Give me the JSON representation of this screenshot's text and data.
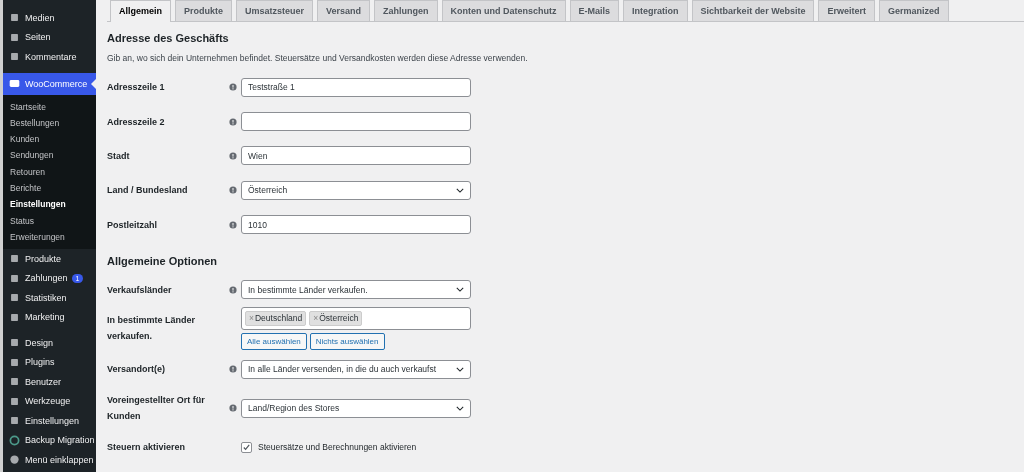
{
  "sidebar": {
    "groups": [
      [
        {
          "label": "Medien",
          "selected": false
        },
        {
          "label": "Seiten",
          "selected": false
        },
        {
          "label": "Kommentare",
          "selected": false
        }
      ],
      [
        {
          "label": "WooCommerce",
          "selected": true,
          "children": [
            {
              "label": "Startseite",
              "selected": false
            },
            {
              "label": "Bestellungen",
              "selected": false
            },
            {
              "label": "Kunden",
              "selected": false
            },
            {
              "label": "Sendungen",
              "selected": false
            },
            {
              "label": "Retouren",
              "selected": false
            },
            {
              "label": "Berichte",
              "selected": false
            },
            {
              "label": "Einstellungen",
              "selected": true
            },
            {
              "label": "Status",
              "selected": false
            },
            {
              "label": "Erweiterungen",
              "selected": false
            }
          ]
        },
        {
          "label": "Produkte",
          "selected": false
        },
        {
          "label": "Zahlungen",
          "selected": false,
          "badge": "1"
        },
        {
          "label": "Statistiken",
          "selected": false
        },
        {
          "label": "Marketing",
          "selected": false
        }
      ],
      [
        {
          "label": "Design",
          "selected": false
        },
        {
          "label": "Plugins",
          "selected": false
        },
        {
          "label": "Benutzer",
          "selected": false
        },
        {
          "label": "Werkzeuge",
          "selected": false
        },
        {
          "label": "Einstellungen",
          "selected": false
        },
        {
          "label": "Backup Migration",
          "selected": false
        },
        {
          "label": "Menü einklappen",
          "selected": false
        }
      ]
    ]
  },
  "tabs": [
    {
      "label": "Allgemein",
      "selected": true
    },
    {
      "label": "Produkte",
      "selected": false
    },
    {
      "label": "Umsatzsteuer",
      "selected": false
    },
    {
      "label": "Versand",
      "selected": false
    },
    {
      "label": "Zahlungen",
      "selected": false
    },
    {
      "label": "Konten und Datenschutz",
      "selected": false
    },
    {
      "label": "E-Mails",
      "selected": false
    },
    {
      "label": "Integration",
      "selected": false
    },
    {
      "label": "Sichtbarkeit der Website",
      "selected": false
    },
    {
      "label": "Erweitert",
      "selected": false
    },
    {
      "label": "Germanized",
      "selected": false
    }
  ],
  "sections": [
    {
      "title": "Adresse des Geschäfts",
      "description": "Gib an, wo sich dein Unternehmen befindet. Steuersätze und Versandkosten werden diese Adresse verwenden.",
      "rows": [
        {
          "kind": "text",
          "label": "Adresszeile 1",
          "help": true,
          "value": "Teststraße 1"
        },
        {
          "kind": "text",
          "label": "Adresszeile 2",
          "help": true
        },
        {
          "kind": "text",
          "label": "Stadt",
          "help": true,
          "value": "Wien"
        },
        {
          "kind": "select",
          "label": "Land / Bundesland",
          "help": true,
          "value": "Österreich"
        },
        {
          "kind": "text",
          "label": "Postleitzahl",
          "help": true,
          "value": "1010"
        }
      ]
    },
    {
      "title": "Allgemeine Optionen",
      "rows": [
        {
          "kind": "select",
          "label": "Verkaufsländer",
          "help": true,
          "value": "In bestimmte Länder verkaufen."
        },
        {
          "kind": "multiselect",
          "label": "In bestimmte Länder verkaufen.",
          "help": false,
          "tags": [
            "Deutschland",
            "Österreich"
          ],
          "remove_mark": "×",
          "buttons": [
            "Alle auswählen",
            "Nichts auswählen"
          ]
        },
        {
          "kind": "select",
          "label": "Versandort(e)",
          "help": true,
          "value": "In alle Länder versenden, in die du auch verkaufst"
        },
        {
          "kind": "select",
          "label": "Voreingestellter Ort für Kunden",
          "help": true,
          "value": "Land/Region des Stores"
        },
        {
          "kind": "checkbox",
          "label": "Steuern aktivieren",
          "help": false,
          "checked": true,
          "text": "Steuersätze und Berechnungen aktivieren"
        }
      ]
    }
  ]
}
